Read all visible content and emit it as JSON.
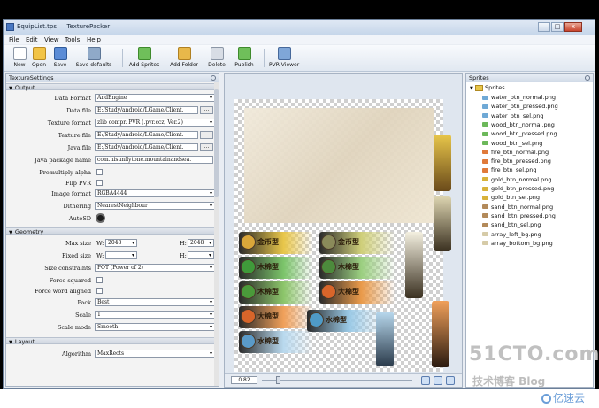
{
  "window": {
    "title": "EquipList.tps — TexturePacker",
    "controls": {
      "minimize": "—",
      "maximize": "□",
      "close": "x"
    }
  },
  "menu": [
    "File",
    "Edit",
    "View",
    "Tools",
    "Help"
  ],
  "toolbar": [
    {
      "label": "New",
      "icon": "new-file-icon",
      "color": "#ffffff"
    },
    {
      "label": "Open",
      "icon": "folder-open-icon",
      "color": "#f2c447"
    },
    {
      "label": "Save",
      "icon": "save-icon",
      "color": "#5b8cd6"
    },
    {
      "label": "Save defaults",
      "icon": "save-defaults-icon",
      "color": "#8fa9c8"
    },
    {
      "label": "Add Sprites",
      "icon": "add-sprites-icon",
      "color": "#6fbf5a"
    },
    {
      "label": "Add Folder",
      "icon": "add-folder-icon",
      "color": "#e8b84a"
    },
    {
      "label": "Delete",
      "icon": "delete-icon",
      "color": "#d8dde5"
    },
    {
      "label": "Publish",
      "icon": "publish-icon",
      "color": "#6fbf5a"
    },
    {
      "label": "PVR Viewer",
      "icon": "pvr-viewer-icon",
      "color": "#7fa6d8"
    }
  ],
  "left_panel": {
    "title": "TextureSettings",
    "sections": {
      "output": "Output",
      "geometry": "Geometry",
      "layout": "Layout"
    },
    "output": {
      "data_format": {
        "label": "Data Format",
        "value": "AndEngine"
      },
      "data_file": {
        "label": "Data file",
        "value": "E:/Study/android/LGame/Client."
      },
      "texture_format": {
        "label": "Texture format",
        "value": "zlib compr. PVR (.pvr.ccz, Ver.2)"
      },
      "texture_file": {
        "label": "Texture file",
        "value": "E:/Study/android/LGame/Client."
      },
      "java_file": {
        "label": "Java file",
        "value": "E:/Study/android/LGame/Client."
      },
      "java_package": {
        "label": "Java package name",
        "value": "com.hisunflytone.mountainandsea."
      },
      "premultiply_alpha": {
        "label": "Premultiply alpha"
      },
      "flip_pvr": {
        "label": "Flip PVR"
      },
      "image_format": {
        "label": "Image format",
        "value": "RGBA4444"
      },
      "dithering": {
        "label": "Dithering",
        "value": "NearestNeighbour"
      },
      "autosd": {
        "label": "AutoSD"
      }
    },
    "geometry": {
      "max_size": {
        "label": "Max size",
        "w_label": "W:",
        "w_value": "2048",
        "h_label": "H:",
        "h_value": "2048"
      },
      "fixed_size": {
        "label": "Fixed size",
        "w_label": "W:",
        "h_label": "H:"
      },
      "size_constraints": {
        "label": "Size constraints",
        "value": "POT (Power of 2)"
      },
      "force_squared": {
        "label": "Force squared"
      },
      "force_word_aligned": {
        "label": "Force word aligned"
      },
      "pack": {
        "label": "Pack",
        "value": "Best"
      },
      "scale": {
        "label": "Scale",
        "value": "1"
      },
      "scale_mode": {
        "label": "Scale mode",
        "value": "Smooth"
      }
    },
    "layout": {
      "algorithm": {
        "label": "Algorithm",
        "value": "MaxRects"
      }
    },
    "browse_label": "..."
  },
  "canvas": {
    "zoom": "0.82",
    "sprites": [
      {
        "text": "金币型",
        "color": "#e8c64a",
        "orb": "#d9a63a"
      },
      {
        "text": "金币型",
        "color": "#cfcf7a",
        "orb": "#8a8a5a"
      },
      {
        "text": "木棉型",
        "color": "#7bc46a",
        "orb": "#3f9a3a"
      },
      {
        "text": "木棉型",
        "color": "#9bcf80",
        "orb": "#4c8a3c"
      },
      {
        "text": "木棉型",
        "color": "#8cc56a",
        "orb": "#4a9a3a"
      },
      {
        "text": "大棉型",
        "color": "#e99a4a",
        "orb": "#d8652a"
      },
      {
        "text": "大棉型",
        "color": "#f0a05a",
        "orb": "#d8652a"
      },
      {
        "text": "水棉型",
        "color": "#9ac9e6",
        "orb": "#4f9ac6"
      },
      {
        "text": "水棉型",
        "color": "#b9d9ee",
        "orb": "#5a9ac8"
      }
    ]
  },
  "right_panel": {
    "title": "Sprites",
    "root": "Sprites",
    "items": [
      {
        "name": "water_btn_normal.png",
        "color": "#6fa9d6"
      },
      {
        "name": "water_btn_pressed.png",
        "color": "#6fa9d6"
      },
      {
        "name": "water_btn_sel.png",
        "color": "#6fa9d6"
      },
      {
        "name": "wood_btn_normal.png",
        "color": "#6cb85a"
      },
      {
        "name": "wood_btn_pressed.png",
        "color": "#6cb85a"
      },
      {
        "name": "wood_btn_sel.png",
        "color": "#6cb85a"
      },
      {
        "name": "fire_btn_normal.png",
        "color": "#e07a3a"
      },
      {
        "name": "fire_btn_pressed.png",
        "color": "#e07a3a"
      },
      {
        "name": "fire_btn_sel.png",
        "color": "#e07a3a"
      },
      {
        "name": "gold_btn_normal.png",
        "color": "#d8b23a"
      },
      {
        "name": "gold_btn_pressed.png",
        "color": "#d8b23a"
      },
      {
        "name": "gold_btn_sel.png",
        "color": "#d8b23a"
      },
      {
        "name": "sand_btn_normal.png",
        "color": "#b38a5a"
      },
      {
        "name": "sand_btn_pressed.png",
        "color": "#b38a5a"
      },
      {
        "name": "sand_btn_sel.png",
        "color": "#b38a5a"
      },
      {
        "name": "array_left_bg.png",
        "color": "#d6cba8"
      },
      {
        "name": "array_bottom_bg.png",
        "color": "#d6cba8"
      }
    ]
  },
  "watermarks": {
    "site": "51CTO.com",
    "blog": "技术博客 Blog",
    "logo": "亿速云"
  }
}
